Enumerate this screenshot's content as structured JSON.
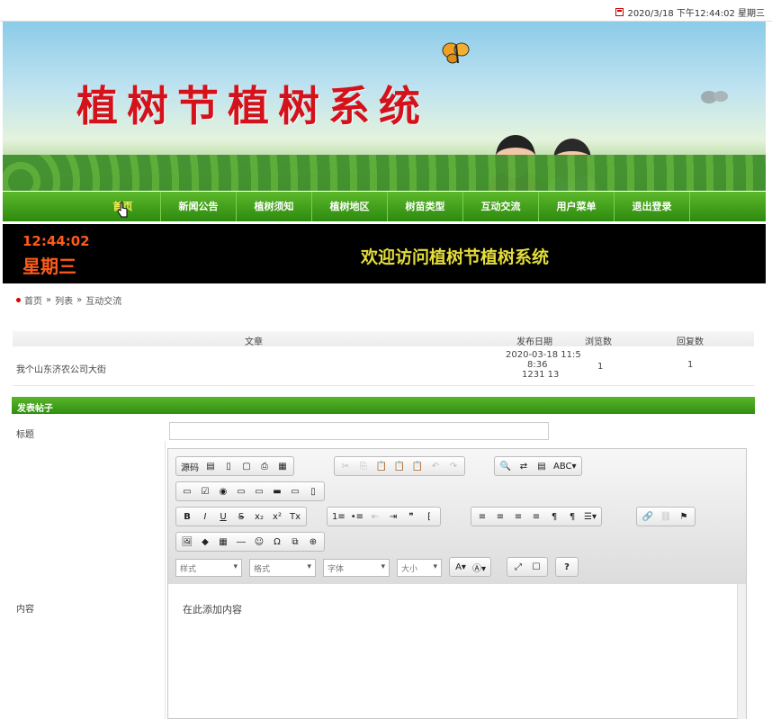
{
  "topbar": {
    "datetime": "2020/3/18 下午12:44:02 星期三"
  },
  "banner": {
    "title": "植树节植树系统"
  },
  "nav": {
    "items": [
      "首页",
      "新闻公告",
      "植树须知",
      "植树地区",
      "树苗类型",
      "互动交流",
      "用户菜单",
      "退出登录"
    ],
    "active": 0
  },
  "clock": {
    "time": "12:44:02",
    "weekday": "星期三",
    "welcome": "欢迎访问植树节植树系统"
  },
  "breadcrumb": {
    "home": "首页",
    "sep1": "»",
    "mid": "列表",
    "sep2": "»",
    "current": "互动交流"
  },
  "table": {
    "headers": {
      "title": "文章",
      "date": "发布日期",
      "views": "浏览数",
      "replies": "回复数"
    },
    "rows": [
      {
        "title": "我个山东济农公司大街",
        "date1": "2020-03-18 11:5",
        "date2": "8:36",
        "date3": "1231 13",
        "views": "1",
        "replies": "1"
      }
    ]
  },
  "form": {
    "section": "发表帖子",
    "title_label": "标题",
    "content_label": "内容",
    "content_text": "在此添加内容"
  },
  "editor": {
    "row1": [
      "源码",
      "▤",
      "▯",
      "▢",
      "⎙",
      "▦"
    ],
    "row1b": [
      "✂",
      "⎘",
      "📋",
      "📋",
      "📋",
      "↶",
      "↷"
    ],
    "row1c": [
      "🔍",
      "⇄",
      "▤",
      "ABC▾"
    ],
    "row2": [
      "▭",
      "☑",
      "◉",
      "▭",
      "▭",
      "▬",
      "▭",
      "▯"
    ],
    "row3a": [
      "B",
      "I",
      "U",
      "S",
      "x₂",
      "x²",
      "Tx"
    ],
    "row3b": [
      "1≡",
      "•≡",
      "⇤",
      "⇥",
      "❞",
      "⁅"
    ],
    "row3c": [
      "≡",
      "≡",
      "≡",
      "≡",
      "¶",
      "¶",
      "☰▾"
    ],
    "row3d": [
      "🔗",
      "⛓",
      "⚑"
    ],
    "row4": [
      "🖼",
      "◆",
      "▦",
      "―",
      "☺",
      "Ω",
      "⧉",
      "⊕"
    ],
    "combos": [
      "样式",
      "格式",
      "字体",
      "大小"
    ],
    "row5": [
      "A▾",
      "Ⓐ▾",
      "⤢",
      "☐",
      "?"
    ]
  }
}
